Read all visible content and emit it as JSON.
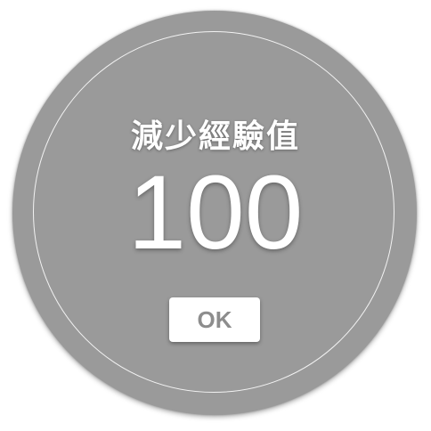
{
  "dialog": {
    "title": "減少經驗值",
    "value": "100",
    "ok_label": "OK"
  },
  "colors": {
    "badge_fill": "#9a9a9a",
    "ring": "#f2f2f2",
    "text": "#ffffff",
    "button_fill": "#ffffff",
    "button_text": "#8d8d8d"
  }
}
